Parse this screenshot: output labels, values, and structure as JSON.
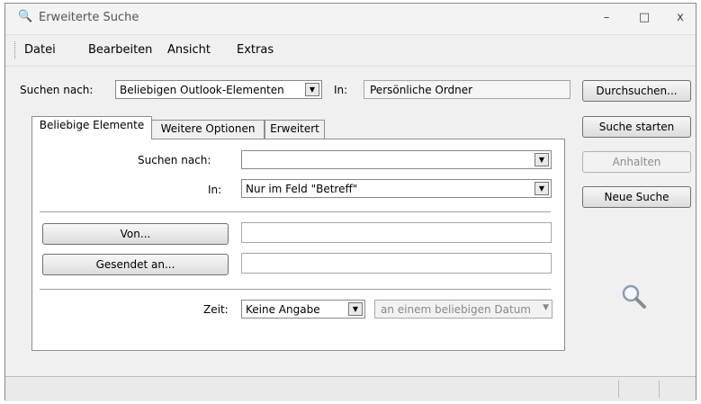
{
  "window": {
    "title": "Erweiterte Suche",
    "minimize_glyph": "–",
    "maximize_glyph": "□",
    "close_glyph": "x"
  },
  "menu": [
    "Datei",
    "Bearbeiten",
    "Ansicht",
    "Extras"
  ],
  "search_scope": {
    "label": "Suchen nach:",
    "value": "Beliebigen Outlook-Elementen",
    "in_label": "In:",
    "in_value": "Persönliche Ordner"
  },
  "tabs": [
    "Beliebige Elemente",
    "Weitere Optionen",
    "Erweitert"
  ],
  "form": {
    "search_label": "Suchen nach:",
    "search_value": "",
    "in_label": "In:",
    "in_value": "Nur im Feld \"Betreff\"",
    "from_button": "Von...",
    "from_value": "",
    "sent_to_button": "Gesendet an...",
    "sent_to_value": "",
    "time_label": "Zeit:",
    "time_value": "Keine Angabe",
    "date_value": "an einem beliebigen Datum"
  },
  "buttons": {
    "browse": "Durchsuchen...",
    "start": "Suche starten",
    "stop": "Anhalten",
    "new": "Neue Suche"
  }
}
